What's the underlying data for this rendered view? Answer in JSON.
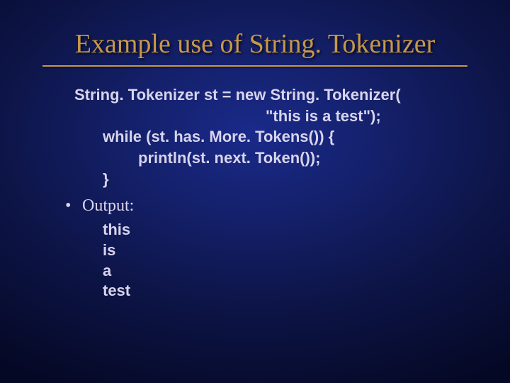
{
  "title": "Example use of String. Tokenizer",
  "code": {
    "l1": "String. Tokenizer st = new String. Tokenizer(",
    "l2": "\"this is a test\");",
    "l3": "while (st. has. More. Tokens()) {",
    "l4": "println(st. next. Token());",
    "l5": "}"
  },
  "bullet_label": "Output:",
  "output": {
    "o1": "this",
    "o2": "is",
    "o3": "a",
    "o4": "test"
  }
}
